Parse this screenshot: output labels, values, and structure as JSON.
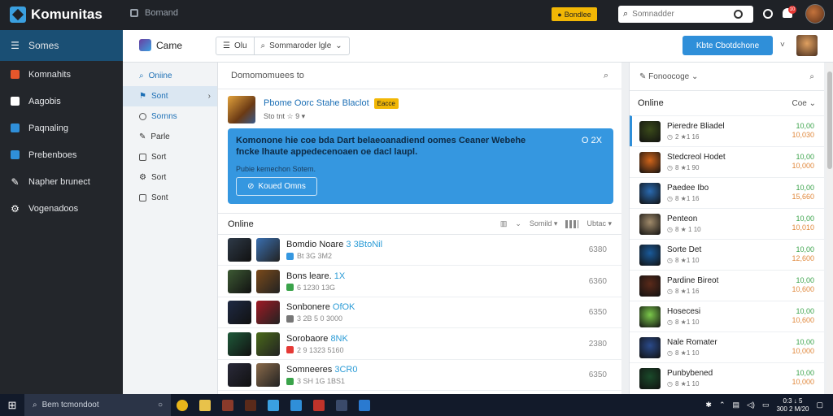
{
  "app": {
    "brand": "Komunitas"
  },
  "topbar": {
    "nav_label": "Bomand",
    "badge_label": "Bondlee",
    "search_placeholder": "Somnadder",
    "notif_count": "10"
  },
  "leftnav": {
    "items": [
      {
        "label": "Somes",
        "icon": "hamburger-icon",
        "color": "#ffffff"
      },
      {
        "label": "Komnahits",
        "icon": "game-icon",
        "color": "#e5562b"
      },
      {
        "label": "Aagobis",
        "icon": "bag-icon",
        "color": "#ffffff"
      },
      {
        "label": "Paqnaling",
        "icon": "document-icon",
        "color": "#2f8fd9"
      },
      {
        "label": "Prebenboes",
        "icon": "folder-icon",
        "color": "#2f8fd9"
      },
      {
        "label": "Napher brunect",
        "icon": "tools-icon",
        "color": "#ffffff"
      },
      {
        "label": "Vogenadoos",
        "icon": "settings-icon",
        "color": "#ffffff"
      }
    ]
  },
  "header": {
    "title": "Came",
    "seg_1": "Olu",
    "seg_2": "Sommaroder lgle",
    "primary_button": "Kbte Cbotdchone",
    "chevron": "˅"
  },
  "subnav": {
    "items": [
      {
        "label": "Oniine",
        "style": "blue"
      },
      {
        "label": "Sont",
        "style": "sel"
      },
      {
        "label": "Sornns",
        "style": "blue"
      },
      {
        "label": "Parle",
        "style": ""
      },
      {
        "label": "Sort",
        "style": ""
      },
      {
        "label": "Sort",
        "style": ""
      },
      {
        "label": "Sont",
        "style": ""
      }
    ]
  },
  "center": {
    "search_placeholder": "Domomomuees to",
    "game": {
      "name": "Pbome Oorc Stahe Blaclot",
      "tag": "Eacce",
      "meta": "Sto tnt ☆ 9 ▾"
    },
    "banner": {
      "title": "Komonone hie coe bda Dart belaeoanadiend oomes Ceaner Webehe fncke lhaute appedecenoaen oe dacl laupl.",
      "subtitle": "Pubie kemechon Sotem.",
      "counter": "O 2X",
      "button": "Koued Omns"
    },
    "list_title": "Online",
    "list_controls": {
      "sort": "Somild",
      "filter": "Ubtac"
    },
    "rows": [
      {
        "name": "Bomdio Noare",
        "hl": "3 3BtoNil",
        "meta": "Bt 3G 3M2",
        "value": "6380",
        "c1": "#2e3a48",
        "c2": "#3a6fb0",
        "mc": "#3597e0"
      },
      {
        "name": "Bons leare.",
        "hl": "1X",
        "meta": "6 1230 13G",
        "value": "6360",
        "c1": "#3d5a34",
        "c2": "#7a4a1a",
        "mc": "#3aa34a"
      },
      {
        "name": "Sonbonere",
        "hl": "OfOK",
        "meta": "3 2B 5 0 3000",
        "value": "6350",
        "c1": "#1f2a44",
        "c2": "#a01a24",
        "mc": "#777777"
      },
      {
        "name": "Sorobaore",
        "hl": "8NK",
        "meta": "2 9 1323 5160",
        "value": "2380",
        "c1": "#1f5a3a",
        "c2": "#4a6a1a",
        "mc": "#e53935"
      },
      {
        "name": "Somneeres",
        "hl": "3CR0",
        "meta": "3 SH 1G 1BS1",
        "value": "6350",
        "c1": "#2a2a3a",
        "c2": "#8a6a4a",
        "mc": "#3aa34a"
      }
    ]
  },
  "right": {
    "filter_label": "Fonoocoge",
    "title": "Online",
    "sort_label": "Coe",
    "sort_chevron": "⌄",
    "players": [
      {
        "name": "Pieredre Bliadel",
        "meta": "2 ★1 16",
        "v1": "10,00",
        "v2": "10,030",
        "color": "#3a4a1a",
        "active": true
      },
      {
        "name": "Stedcreol Hodet",
        "meta": "8 ★1 90",
        "v1": "10,00",
        "v2": "10,000",
        "color": "#d0641a",
        "active": false
      },
      {
        "name": "Paedee Ibo",
        "meta": "8 ★1 16",
        "v1": "10,00",
        "v2": "15,660",
        "color": "#2a6ab0",
        "active": false
      },
      {
        "name": "Penteon",
        "meta": "8 ★ 1 10",
        "v1": "10,00",
        "v2": "10,010",
        "color": "#a08a6a",
        "active": false
      },
      {
        "name": "Sorte Det",
        "meta": "8 ★1 10",
        "v1": "10,00",
        "v2": "12,600",
        "color": "#1a5a9a",
        "active": false
      },
      {
        "name": "Pardine Bireot",
        "meta": "8 ★1 16",
        "v1": "10,00",
        "v2": "10,600",
        "color": "#5a2a1a",
        "active": false
      },
      {
        "name": "Hosecesi",
        "meta": "8 ★1 10",
        "v1": "10,00",
        "v2": "10,600",
        "color": "#7ac84a",
        "active": false
      },
      {
        "name": "Nale Romater",
        "meta": "8 ★1 10",
        "v1": "10,00",
        "v2": "10,000",
        "color": "#2a4a8a",
        "active": false
      },
      {
        "name": "Punbybened",
        "meta": "8 ★1 10",
        "v1": "10,00",
        "v2": "10,000",
        "color": "#1a4a2a",
        "active": false
      }
    ]
  },
  "taskbar": {
    "search_placeholder": "Bem tcmondoot",
    "apps": [
      {
        "icon": "chrome-icon",
        "color": "#e8b51a"
      },
      {
        "icon": "folder-icon",
        "color": "#e8c24a"
      },
      {
        "icon": "media-icon",
        "color": "#8a3a2a"
      },
      {
        "icon": "game-icon",
        "color": "#5a2a1a"
      },
      {
        "icon": "explorer-icon",
        "color": "#3aa0e0"
      },
      {
        "icon": "word-icon",
        "color": "#2f8fd9"
      },
      {
        "icon": "app-icon",
        "color": "#c0332a"
      },
      {
        "icon": "settings-icon",
        "color": "#3a4a6a"
      },
      {
        "icon": "window-icon",
        "color": "#2a7ad0"
      }
    ],
    "time": "0:3 ↓ 5",
    "date": "300 2 M/20"
  }
}
